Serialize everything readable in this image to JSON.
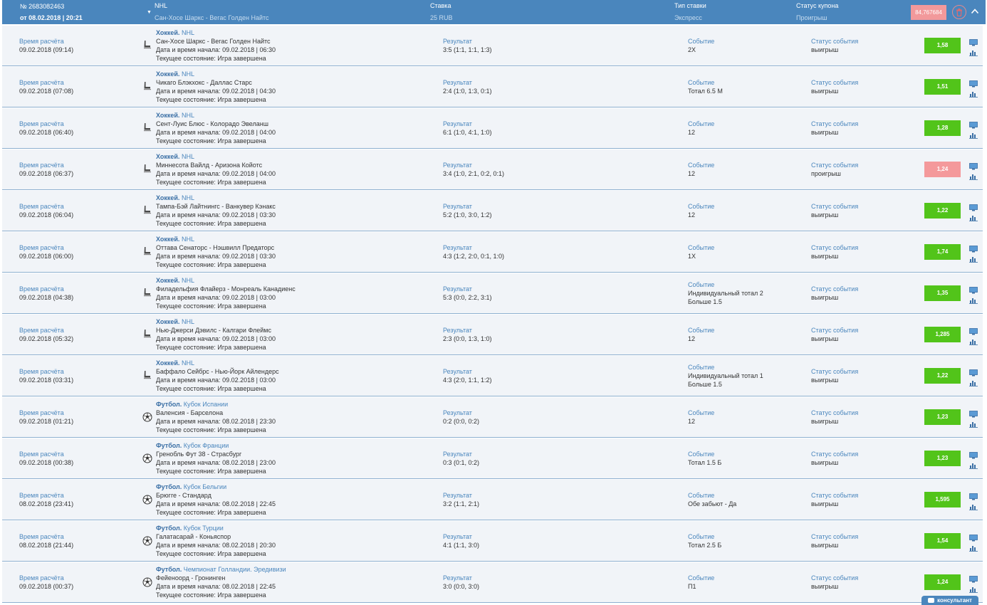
{
  "coupon": {
    "number": "№ 2683082463",
    "date": "от 08.02.2018 | 20:21",
    "league": "NHL",
    "match": "Сан-Хосе Шаркс - Вегас Голден Найтс",
    "stake_label": "Ставка",
    "stake": "25 RUB",
    "bet_type_label": "Тип ставки",
    "bet_type": "Экспресс",
    "status_label": "Статус купона",
    "status": "Проигрыш",
    "total_odds": "84,767684"
  },
  "labels": {
    "calc_time": "Время расчёта",
    "start": "Дата и время начала:",
    "state": "Текущее состояние:",
    "result": "Результат",
    "event": "Событие",
    "event_status": "Статус события",
    "consultant": "консультант"
  },
  "rows": [
    {
      "calc": "09.02.2018 (09:14)",
      "sport": "Хоккей.",
      "league": "NHL",
      "match": "Сан-Хосе Шаркс - Вегас Голден Найтс",
      "start": "09.02.2018 | 06:30",
      "state": "Игра завершена",
      "result": "3:5 (1:1, 1:1, 1:3)",
      "event": "2Х",
      "event2": "",
      "estatus": "выигрыш",
      "odds": "1,58",
      "lost": false,
      "icon": "hockey-icon"
    },
    {
      "calc": "09.02.2018 (07:08)",
      "sport": "Хоккей.",
      "league": "NHL",
      "match": "Чикаго Блэкхокс - Даллас Старс",
      "start": "09.02.2018 | 04:30",
      "state": "Игра завершена",
      "result": "2:4 (1:0, 1:3, 0:1)",
      "event": "Тотал 6.5 М",
      "event2": "",
      "estatus": "выигрыш",
      "odds": "1,51",
      "lost": false,
      "icon": "hockey-icon"
    },
    {
      "calc": "09.02.2018 (06:40)",
      "sport": "Хоккей.",
      "league": "NHL",
      "match": "Сент-Луис Блюс - Колорадо Эвеланш",
      "start": "09.02.2018 | 04:00",
      "state": "Игра завершена",
      "result": "6:1 (1:0, 4:1, 1:0)",
      "event": "12",
      "event2": "",
      "estatus": "выигрыш",
      "odds": "1,28",
      "lost": false,
      "icon": "hockey-icon"
    },
    {
      "calc": "09.02.2018 (06:37)",
      "sport": "Хоккей.",
      "league": "NHL",
      "match": "Миннесота Вайлд - Аризона Койотс",
      "start": "09.02.2018 | 04:00",
      "state": "Игра завершена",
      "result": "3:4 (1:0, 2:1, 0:2, 0:1)",
      "event": "12",
      "event2": "",
      "estatus": "проигрыш",
      "odds": "1,24",
      "lost": true,
      "icon": "hockey-icon"
    },
    {
      "calc": "09.02.2018 (06:04)",
      "sport": "Хоккей.",
      "league": "NHL",
      "match": "Тампа-Бэй Лайтнингс - Ванкувер Кэнакс",
      "start": "09.02.2018 | 03:30",
      "state": "Игра завершена",
      "result": "5:2 (1:0, 3:0, 1:2)",
      "event": "12",
      "event2": "",
      "estatus": "выигрыш",
      "odds": "1,22",
      "lost": false,
      "icon": "hockey-icon"
    },
    {
      "calc": "09.02.2018 (06:00)",
      "sport": "Хоккей.",
      "league": "NHL",
      "match": "Оттава Сенаторс - Нэшвилл Предаторс",
      "start": "09.02.2018 | 03:30",
      "state": "Игра завершена",
      "result": "4:3 (1:2, 2:0, 0:1, 1:0)",
      "event": "1Х",
      "event2": "",
      "estatus": "выигрыш",
      "odds": "1,74",
      "lost": false,
      "icon": "hockey-icon"
    },
    {
      "calc": "09.02.2018 (04:38)",
      "sport": "Хоккей.",
      "league": "NHL",
      "match": "Филадельфия Флайерз - Монреаль Канадиенс",
      "start": "09.02.2018 | 03:00",
      "state": "Игра завершена",
      "result": "5:3 (0:0, 2:2, 3:1)",
      "event": "Индивидуальный тотал 2",
      "event2": "Больше 1.5",
      "estatus": "выигрыш",
      "odds": "1,35",
      "lost": false,
      "icon": "hockey-icon"
    },
    {
      "calc": "09.02.2018 (05:32)",
      "sport": "Хоккей.",
      "league": "NHL",
      "match": "Нью-Джерси Дэвилс - Калгари Флеймс",
      "start": "09.02.2018 | 03:00",
      "state": "Игра завершена",
      "result": "2:3 (0:0, 1:3, 1:0)",
      "event": "12",
      "event2": "",
      "estatus": "выигрыш",
      "odds": "1,285",
      "lost": false,
      "icon": "hockey-icon"
    },
    {
      "calc": "09.02.2018 (03:31)",
      "sport": "Хоккей.",
      "league": "NHL",
      "match": "Баффало Сейбрс - Нью-Йорк Айлендерс",
      "start": "09.02.2018 | 03:00",
      "state": "Игра завершена",
      "result": "4:3 (2:0, 1:1, 1:2)",
      "event": "Индивидуальный тотал 1",
      "event2": "Больше 1.5",
      "estatus": "выигрыш",
      "odds": "1,22",
      "lost": false,
      "icon": "hockey-icon"
    },
    {
      "calc": "09.02.2018 (01:21)",
      "sport": "Футбол.",
      "league": "Кубок Испании",
      "match": "Валенсия - Барселона",
      "start": "08.02.2018 | 23:30",
      "state": "Игра завершена",
      "result": "0:2 (0:0, 0:2)",
      "event": "12",
      "event2": "",
      "estatus": "выигрыш",
      "odds": "1,23",
      "lost": false,
      "icon": "soccer-ball-icon"
    },
    {
      "calc": "09.02.2018 (00:38)",
      "sport": "Футбол.",
      "league": "Кубок Франции",
      "match": "Гренобль Фут 38 - Страсбург",
      "start": "08.02.2018 | 23:00",
      "state": "Игра завершена",
      "result": "0:3 (0:1, 0:2)",
      "event": "Тотал 1.5 Б",
      "event2": "",
      "estatus": "выигрыш",
      "odds": "1,23",
      "lost": false,
      "icon": "soccer-ball-icon"
    },
    {
      "calc": "08.02.2018 (23:41)",
      "sport": "Футбол.",
      "league": "Кубок Бельгии",
      "match": "Брюгге - Стандард",
      "start": "08.02.2018 | 22:45",
      "state": "Игра завершена",
      "result": "3:2 (1:1, 2:1)",
      "event": "Обе забьют - Да",
      "event2": "",
      "estatus": "выигрыш",
      "odds": "1,595",
      "lost": false,
      "icon": "soccer-ball-icon"
    },
    {
      "calc": "08.02.2018 (21:44)",
      "sport": "Футбол.",
      "league": "Кубок Турции",
      "match": "Галатасарай - Коньяспор",
      "start": "08.02.2018 | 20:30",
      "state": "Игра завершена",
      "result": "4:1 (1:1, 3:0)",
      "event": "Тотал 2.5 Б",
      "event2": "",
      "estatus": "выигрыш",
      "odds": "1,54",
      "lost": false,
      "icon": "soccer-ball-icon"
    },
    {
      "calc": "09.02.2018 (00:37)",
      "sport": "Футбол.",
      "league": "Чемпионат Голландии. Эредивизи",
      "match": "Фейеноорд - Гронинген",
      "start": "08.02.2018 | 22:45",
      "state": "Игра завершена",
      "result": "3:0 (0:0, 3:0)",
      "event": "П1",
      "event2": "",
      "estatus": "выигрыш",
      "odds": "1,24",
      "lost": false,
      "icon": "soccer-ball-icon"
    }
  ]
}
